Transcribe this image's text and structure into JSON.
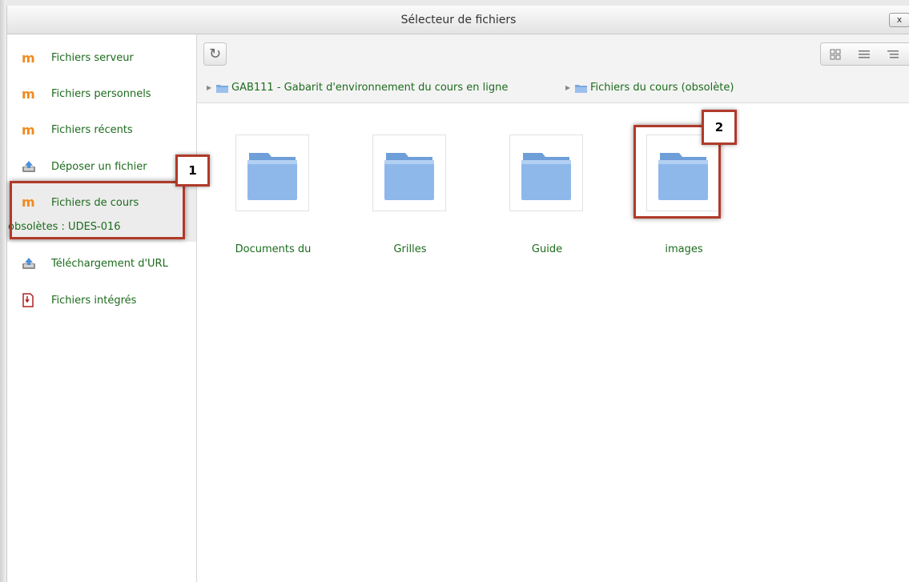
{
  "window": {
    "title": "Sélecteur de fichiers",
    "close_label": "x"
  },
  "sidebar": {
    "items": [
      {
        "label": "Fichiers serveur",
        "icon": "moodle-icon"
      },
      {
        "label": "Fichiers personnels",
        "icon": "moodle-icon"
      },
      {
        "label": "Fichiers récents",
        "icon": "moodle-icon"
      },
      {
        "label": "Déposer un fichier",
        "icon": "upload-icon"
      },
      {
        "label": "Fichiers de cours",
        "label_line2": "obsolètes : UDES-016",
        "icon": "moodle-icon",
        "active": true
      },
      {
        "label": "Téléchargement d'URL",
        "icon": "url-download-icon"
      },
      {
        "label": "Fichiers intégrés",
        "icon": "embedded-files-icon"
      }
    ]
  },
  "toolbar": {
    "refresh_icon": "refresh-icon",
    "views": [
      "icons-view",
      "list-view",
      "tree-view"
    ]
  },
  "breadcrumb": [
    {
      "label": "GAB111 - Gabarit d'environnement du cours en ligne"
    },
    {
      "label": "Fichiers du cours (obsolète)"
    }
  ],
  "folders": [
    {
      "label": "Documents du"
    },
    {
      "label": "Grilles"
    },
    {
      "label": "Guide"
    },
    {
      "label": "images"
    }
  ],
  "callouts": {
    "first": "1",
    "second": "2"
  },
  "colors": {
    "link_green": "#1d6b1d",
    "callout_red": "#b03a2a",
    "moodle_orange": "#f08a1c",
    "folder_blue": "#6ea2e4"
  }
}
